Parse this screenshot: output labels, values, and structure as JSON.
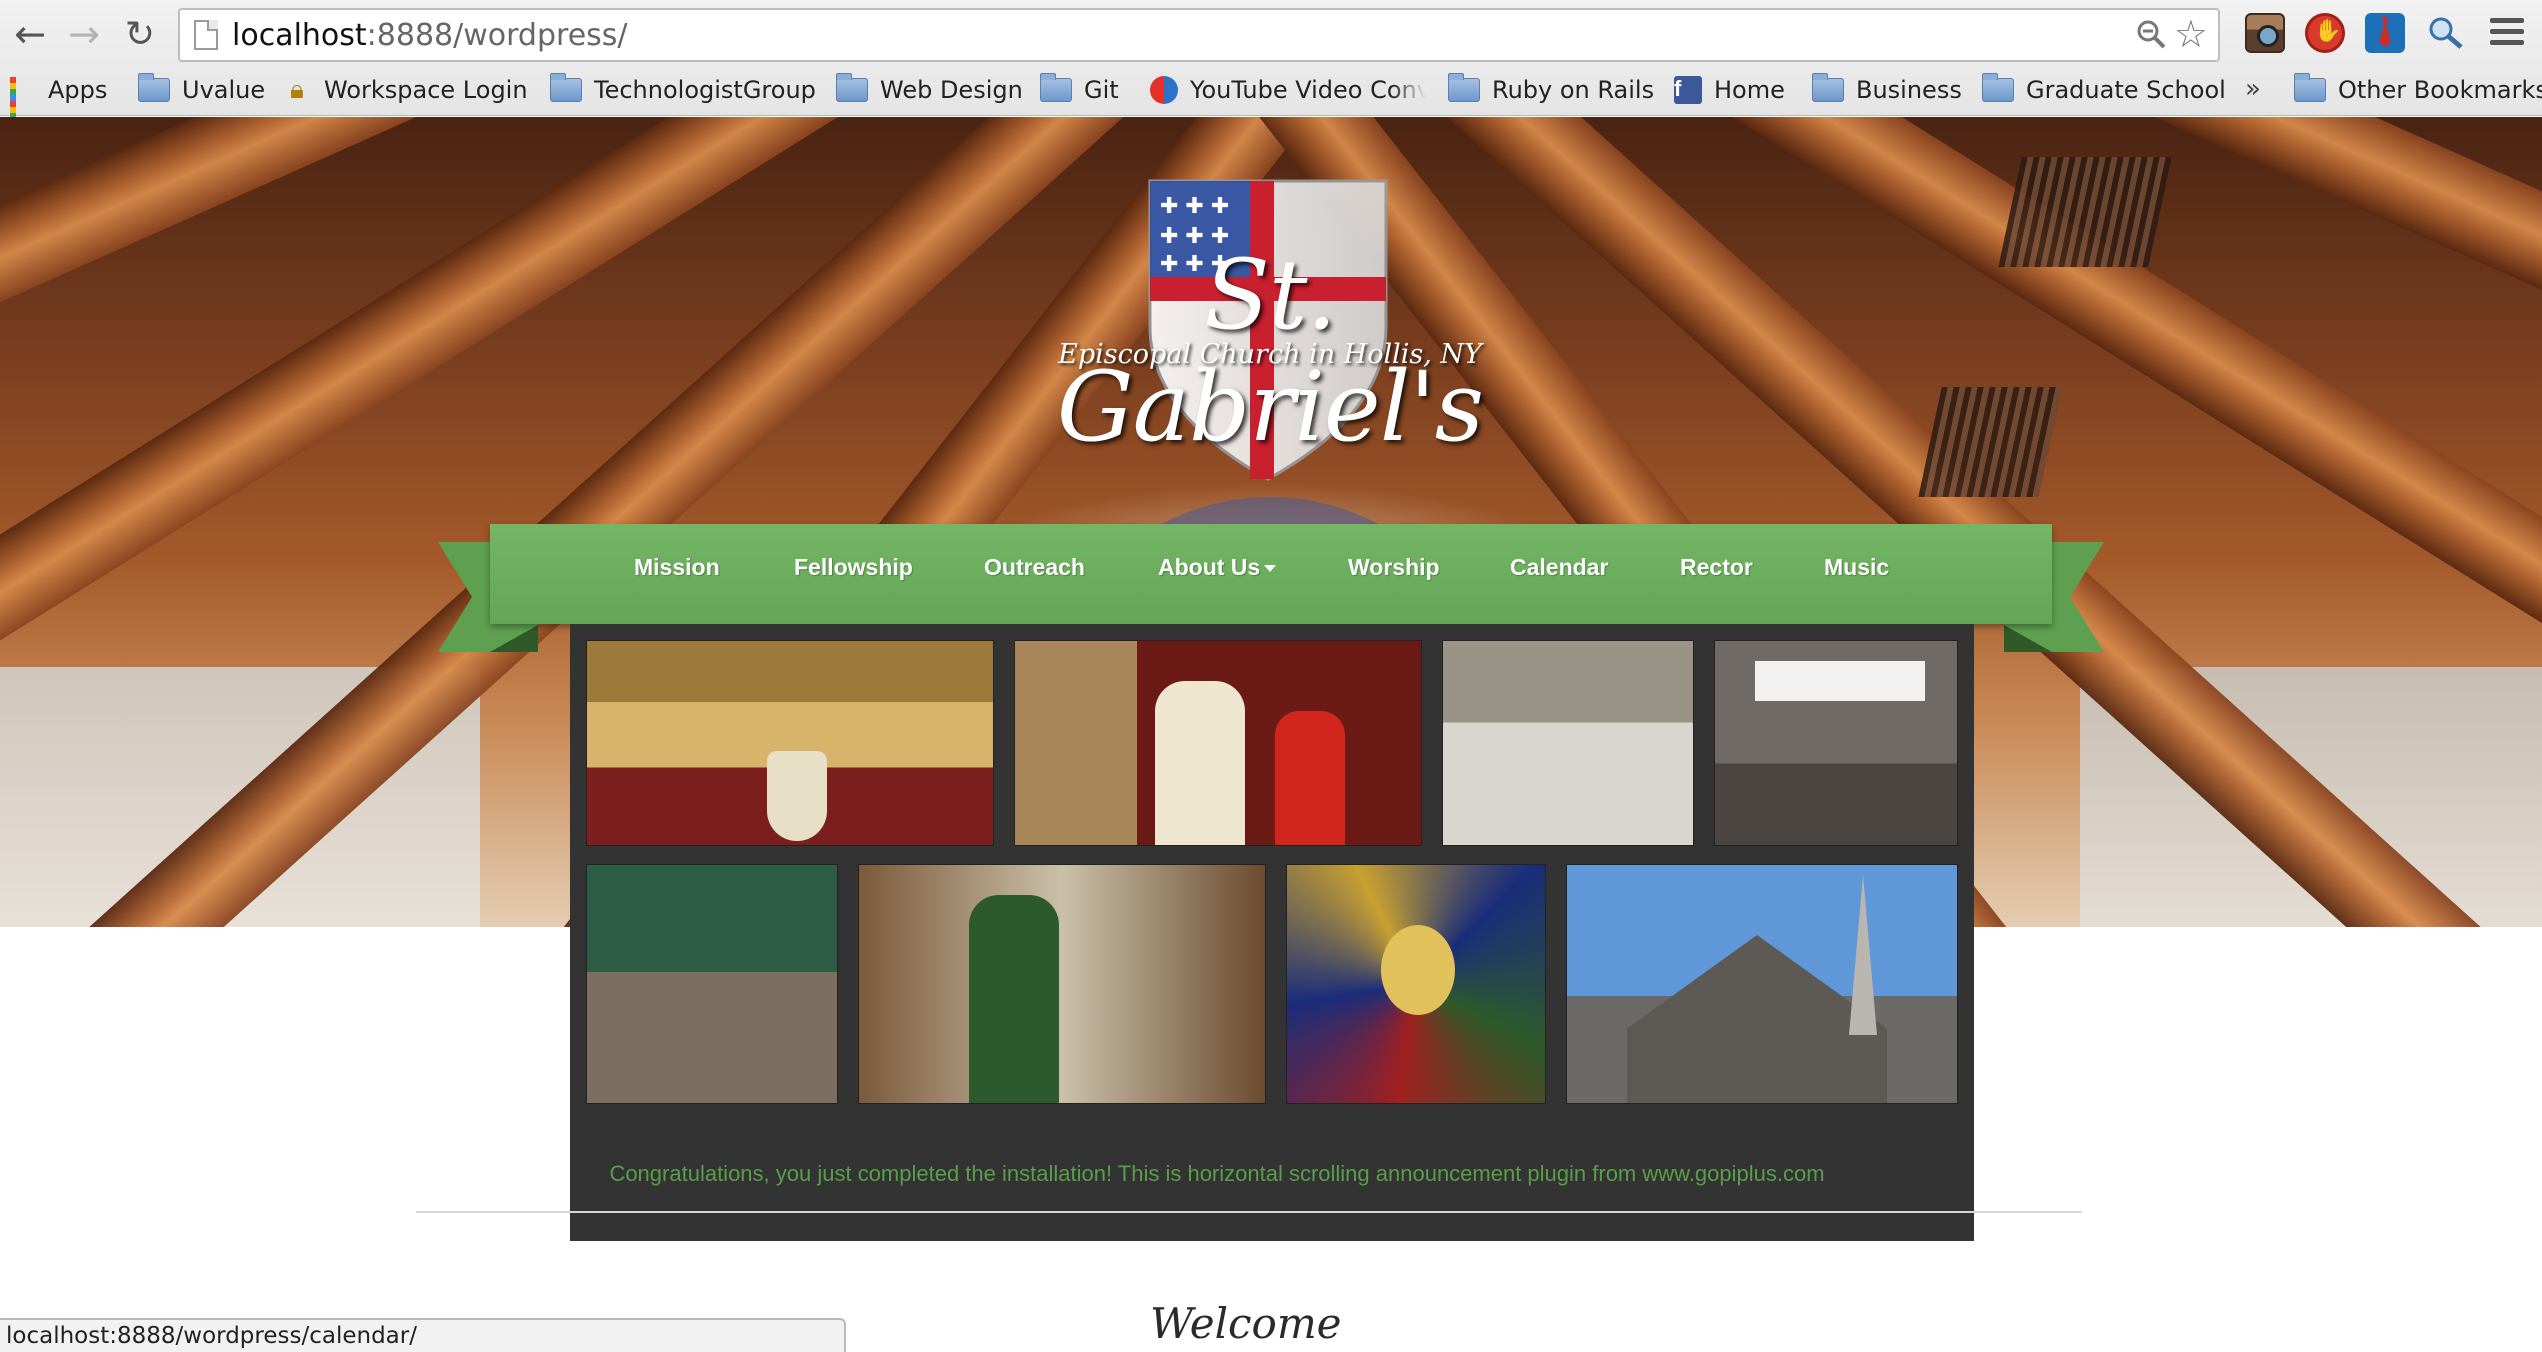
{
  "browser": {
    "url_host": "localhost",
    "url_rest": ":8888/wordpress/",
    "bookmarks": [
      {
        "label": "Apps",
        "icon": "apps-grid-icon"
      },
      {
        "label": "Uvalue",
        "icon": "folder-icon"
      },
      {
        "label": "Workspace Login",
        "icon": "lock-icon"
      },
      {
        "label": "TechnologistGroup",
        "icon": "folder-icon"
      },
      {
        "label": "Web Design",
        "icon": "folder-icon"
      },
      {
        "label": "Git",
        "icon": "folder-icon"
      },
      {
        "label": "YouTube Video Conv",
        "icon": "youtube-converter-icon"
      },
      {
        "label": "Ruby on Rails",
        "icon": "folder-icon"
      },
      {
        "label": "Home",
        "icon": "facebook-icon"
      },
      {
        "label": "Business",
        "icon": "folder-icon"
      },
      {
        "label": "Graduate School",
        "icon": "folder-icon"
      },
      {
        "label": "Other Bookmarks",
        "icon": "folder-icon"
      }
    ],
    "more_bookmarks": "»",
    "status_url": "localhost:8888/wordpress/calendar/"
  },
  "site": {
    "title": "St. Gabriel's",
    "subtitle": "Episcopal Church in Hollis, NY",
    "nav": [
      "Mission",
      "Fellowship",
      "Outreach",
      "About Us",
      "Worship",
      "Calendar",
      "Rector",
      "Music"
    ],
    "announcement": "Congratulations, you just completed the installation! This is horizontal scrolling announcement plugin from www.gopiplus.com",
    "welcome": "Welcome"
  },
  "colors": {
    "nav_green": "#63a655",
    "announce_green": "#5a9e4a",
    "gallery_bg": "#333333",
    "shield_red": "#c8202f",
    "shield_blue": "#2f4fa0"
  }
}
